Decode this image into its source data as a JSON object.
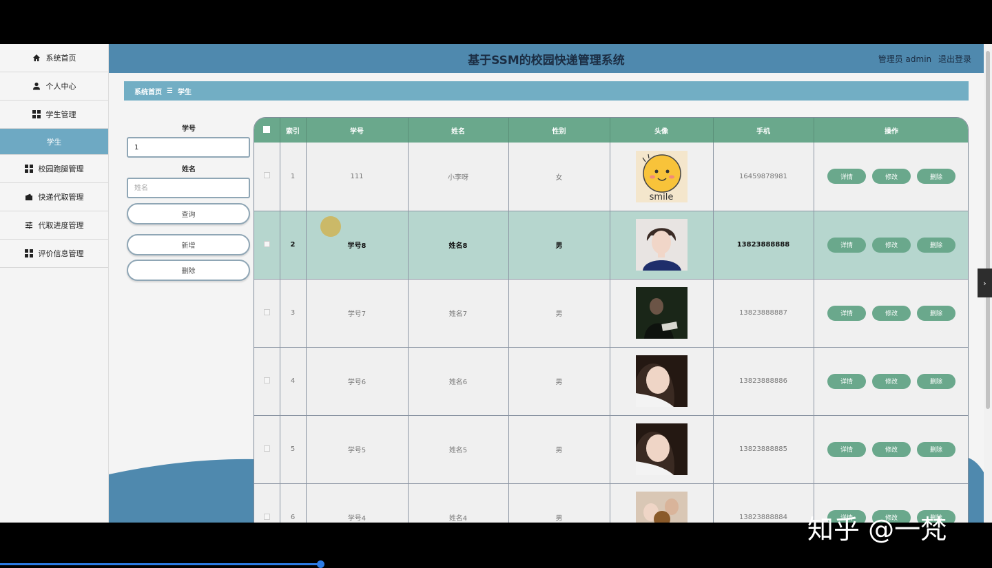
{
  "sidebar": {
    "items": [
      {
        "label": "系统首页",
        "icon": "home-icon"
      },
      {
        "label": "个人中心",
        "icon": "user-icon"
      },
      {
        "label": "学生管理",
        "icon": "grid-icon"
      },
      {
        "label": "学生",
        "icon": ""
      },
      {
        "label": "校园跑腿管理",
        "icon": "grid-icon"
      },
      {
        "label": "快递代取管理",
        "icon": "wallet-icon"
      },
      {
        "label": "代取进度管理",
        "icon": "sliders-icon"
      },
      {
        "label": "评价信息管理",
        "icon": "grid-icon"
      }
    ]
  },
  "header": {
    "title": "基于SSM的校园快递管理系统",
    "user": "管理员 admin",
    "logout": "退出登录"
  },
  "breadcrumb": {
    "home": "系统首页",
    "sep": "☰",
    "current": "学生"
  },
  "search": {
    "label_id": "学号",
    "value_id": "1",
    "label_name": "姓名",
    "placeholder_name": "姓名",
    "query_btn": "查询",
    "add_btn": "新增",
    "delete_btn": "删除"
  },
  "table": {
    "headers": [
      "索引",
      "学号",
      "姓名",
      "性别",
      "头像",
      "手机",
      "操作"
    ],
    "rows": [
      {
        "index": "1",
        "id": "111",
        "name": "小李呀",
        "gender": "女",
        "phone": "16459878981"
      },
      {
        "index": "2",
        "id": "学号8",
        "name": "姓名8",
        "gender": "男",
        "phone": "13823888888"
      },
      {
        "index": "3",
        "id": "学号7",
        "name": "姓名7",
        "gender": "男",
        "phone": "13823888887"
      },
      {
        "index": "4",
        "id": "学号6",
        "name": "姓名6",
        "gender": "男",
        "phone": "13823888886"
      },
      {
        "index": "5",
        "id": "学号5",
        "name": "姓名5",
        "gender": "男",
        "phone": "13823888885"
      },
      {
        "index": "6",
        "id": "学号4",
        "name": "姓名4",
        "gender": "男",
        "phone": "13823888884"
      }
    ],
    "ops": {
      "detail": "详情",
      "edit": "修改",
      "delete": "删除"
    }
  },
  "avatar_text": "smile",
  "watermark": "知乎 @一梵",
  "colors": {
    "header": "#4f89ae",
    "accent": "#6aa88c",
    "active_sidebar": "#6ea9c3",
    "highlight_row": "#b6d6ce"
  }
}
